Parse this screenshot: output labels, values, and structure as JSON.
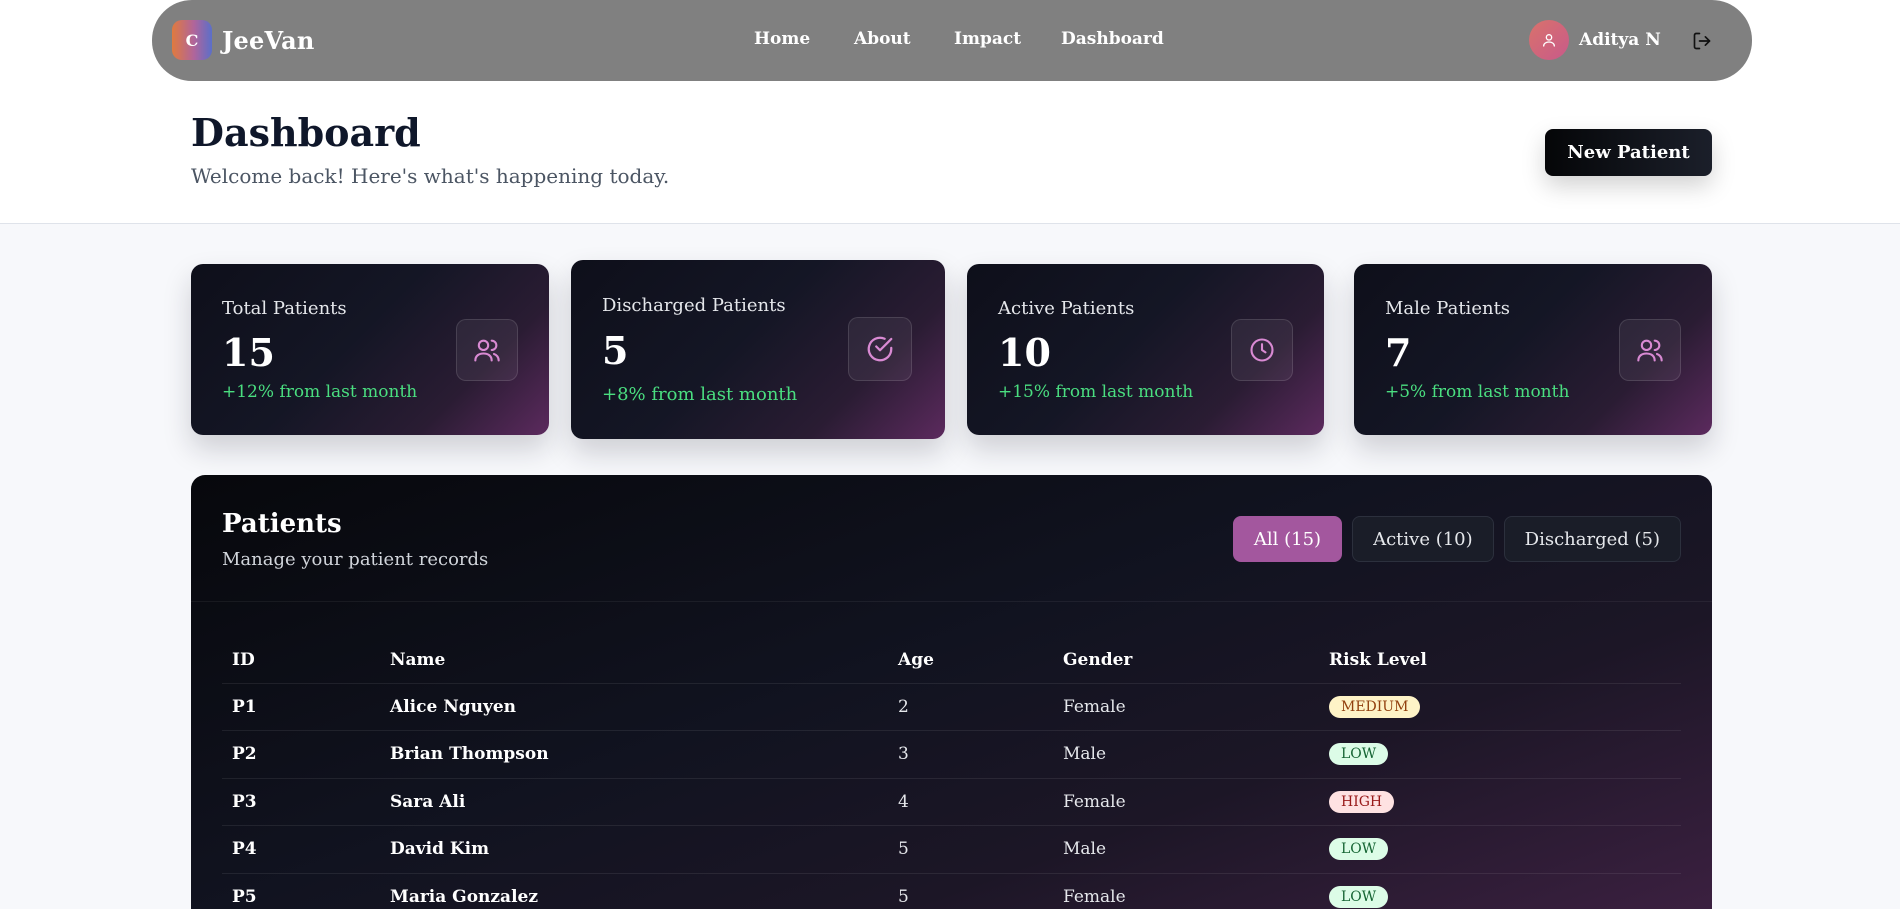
{
  "brand": {
    "logo_letter": "C",
    "name": "JeeVan"
  },
  "nav": {
    "links": [
      "Home",
      "About",
      "Impact",
      "Dashboard"
    ]
  },
  "user": {
    "name": "Aditya N"
  },
  "header": {
    "title": "Dashboard",
    "subtitle": "Welcome back! Here's what's happening today.",
    "new_patient_label": "New Patient"
  },
  "stats": [
    {
      "label": "Total Patients",
      "value": "15",
      "delta": "+12% from last month",
      "icon": "users-icon"
    },
    {
      "label": "Discharged Patients",
      "value": "5",
      "delta": "+8% from last month",
      "icon": "check-circle-icon"
    },
    {
      "label": "Active Patients",
      "value": "10",
      "delta": "+15% from last month",
      "icon": "clock-icon"
    },
    {
      "label": "Male Patients",
      "value": "7",
      "delta": "+5% from last month",
      "icon": "users-icon"
    }
  ],
  "patients_panel": {
    "title": "Patients",
    "subtitle": "Manage your patient records",
    "filters": [
      "All (15)",
      "Active (10)",
      "Discharged (5)"
    ],
    "active_filter": "All (15)",
    "columns": [
      "ID",
      "Name",
      "Age",
      "Gender",
      "Risk Level"
    ],
    "rows": [
      {
        "id": "P1",
        "name": "Alice Nguyen",
        "age": "2",
        "gender": "Female",
        "risk": "MEDIUM"
      },
      {
        "id": "P2",
        "name": "Brian Thompson",
        "age": "3",
        "gender": "Male",
        "risk": "LOW"
      },
      {
        "id": "P3",
        "name": "Sara Ali",
        "age": "4",
        "gender": "Female",
        "risk": "HIGH"
      },
      {
        "id": "P4",
        "name": "David Kim",
        "age": "5",
        "gender": "Male",
        "risk": "LOW"
      },
      {
        "id": "P5",
        "name": "Maria Gonzalez",
        "age": "5",
        "gender": "Female",
        "risk": "LOW"
      }
    ]
  },
  "colors": {
    "accent": "#a3579e",
    "delta_positive": "#4ade80",
    "navbar": "#808080"
  }
}
